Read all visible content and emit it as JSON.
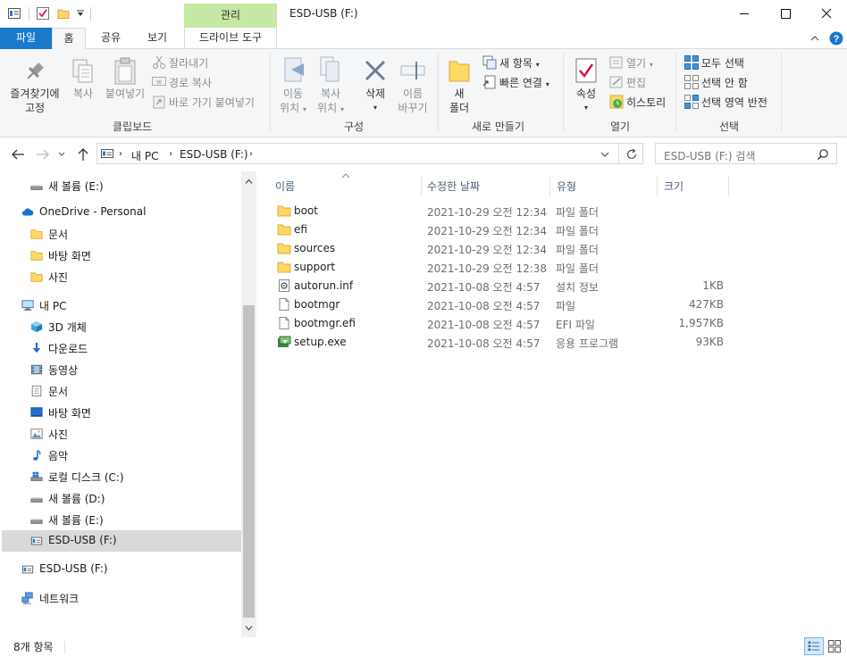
{
  "titlebar": {
    "manage_tab": "관리",
    "title": "ESD-USB (F:)",
    "icons": [
      "properties-icon",
      "checkmark-icon",
      "folder-icon",
      "dropdown-icon"
    ],
    "window_buttons": [
      "minimize-icon",
      "maximize-icon",
      "close-icon"
    ]
  },
  "tabs": {
    "file": "파일",
    "home": "홈",
    "share": "공유",
    "view": "보기",
    "drive_tools": "드라이브 도구"
  },
  "ribbon": {
    "clipboard": {
      "label": "클립보드",
      "pin_line1": "즐겨찾기에",
      "pin_line2": "고정",
      "copy": "복사",
      "paste": "붙여넣기",
      "cut": "잘라내기",
      "copy_path": "경로 복사",
      "paste_shortcut": "바로 가기 붙여넣기"
    },
    "organize": {
      "label": "구성",
      "move_line1": "이동",
      "move_line2": "위치",
      "copyto_line1": "복사",
      "copyto_line2": "위치",
      "delete": "삭제",
      "rename_line1": "이름",
      "rename_line2": "바꾸기"
    },
    "new": {
      "label": "새로 만들기",
      "folder_line1": "새",
      "folder_line2": "폴더",
      "new_item": "새 항목",
      "easy_access": "빠른 연결"
    },
    "open": {
      "label": "열기",
      "properties": "속성",
      "open": "열기",
      "edit": "편집",
      "history": "히스토리"
    },
    "select": {
      "label": "선택",
      "select_all": "모두 선택",
      "select_none": "선택 안 함",
      "invert": "선택 영역 반전"
    }
  },
  "address": {
    "crumbs": [
      "내 PC",
      "ESD-USB (F:)"
    ],
    "search_placeholder": "ESD-USB (F:) 검색"
  },
  "nav": {
    "items": [
      {
        "label": "새 볼륨 (E:)",
        "icon": "drive-icon",
        "indent": 1
      },
      {
        "label": "OneDrive - Personal",
        "icon": "cloud-icon",
        "indent": 0
      },
      {
        "label": "문서",
        "icon": "folder-icon",
        "indent": 1
      },
      {
        "label": "바탕 화면",
        "icon": "folder-icon",
        "indent": 1
      },
      {
        "label": "사진",
        "icon": "folder-icon",
        "indent": 1
      },
      {
        "label": "내 PC",
        "icon": "pc-icon",
        "indent": 0
      },
      {
        "label": "3D 개체",
        "icon": "cube-icon",
        "indent": 1
      },
      {
        "label": "다운로드",
        "icon": "download-icon",
        "indent": 1
      },
      {
        "label": "동영상",
        "icon": "video-icon",
        "indent": 1
      },
      {
        "label": "문서",
        "icon": "document-icon",
        "indent": 1
      },
      {
        "label": "바탕 화면",
        "icon": "desktop-icon",
        "indent": 1
      },
      {
        "label": "사진",
        "icon": "picture-icon",
        "indent": 1
      },
      {
        "label": "음악",
        "icon": "music-icon",
        "indent": 1
      },
      {
        "label": "로컬 디스크 (C:)",
        "icon": "windows-drive-icon",
        "indent": 1
      },
      {
        "label": "새 볼륨 (D:)",
        "icon": "drive-icon",
        "indent": 1
      },
      {
        "label": "새 볼륨 (E:)",
        "icon": "drive-icon",
        "indent": 1
      },
      {
        "label": "ESD-USB (F:)",
        "icon": "usb-drive-icon",
        "indent": 1,
        "selected": true
      },
      {
        "label": "ESD-USB (F:)",
        "icon": "usb-drive-icon",
        "indent": 0
      },
      {
        "label": "네트워크",
        "icon": "network-icon",
        "indent": 0
      }
    ]
  },
  "files": {
    "columns": {
      "name": "이름",
      "date": "수정한 날짜",
      "type": "유형",
      "size": "크기"
    },
    "rows": [
      {
        "name": "boot",
        "date": "2021-10-29 오전 12:34",
        "type": "파일 폴더",
        "size": "",
        "icon": "folder-icon"
      },
      {
        "name": "efi",
        "date": "2021-10-29 오전 12:34",
        "type": "파일 폴더",
        "size": "",
        "icon": "folder-icon"
      },
      {
        "name": "sources",
        "date": "2021-10-29 오전 12:34",
        "type": "파일 폴더",
        "size": "",
        "icon": "folder-icon"
      },
      {
        "name": "support",
        "date": "2021-10-29 오전 12:38",
        "type": "파일 폴더",
        "size": "",
        "icon": "folder-icon"
      },
      {
        "name": "autorun.inf",
        "date": "2021-10-08 오전 4:57",
        "type": "설치 정보",
        "size": "1KB",
        "icon": "settings-file-icon"
      },
      {
        "name": "bootmgr",
        "date": "2021-10-08 오전 4:57",
        "type": "파일",
        "size": "427KB",
        "icon": "file-icon"
      },
      {
        "name": "bootmgr.efi",
        "date": "2021-10-08 오전 4:57",
        "type": "EFI 파일",
        "size": "1,957KB",
        "icon": "file-icon"
      },
      {
        "name": "setup.exe",
        "date": "2021-10-08 오전 4:57",
        "type": "응용 프로그램",
        "size": "93KB",
        "icon": "setup-icon"
      }
    ]
  },
  "status": {
    "count": "8개 항목"
  },
  "colors": {
    "accent": "#1979ca",
    "manage_tab": "#c6e8a4",
    "folder": "#ffd865",
    "selection": "#d9d9d9"
  }
}
